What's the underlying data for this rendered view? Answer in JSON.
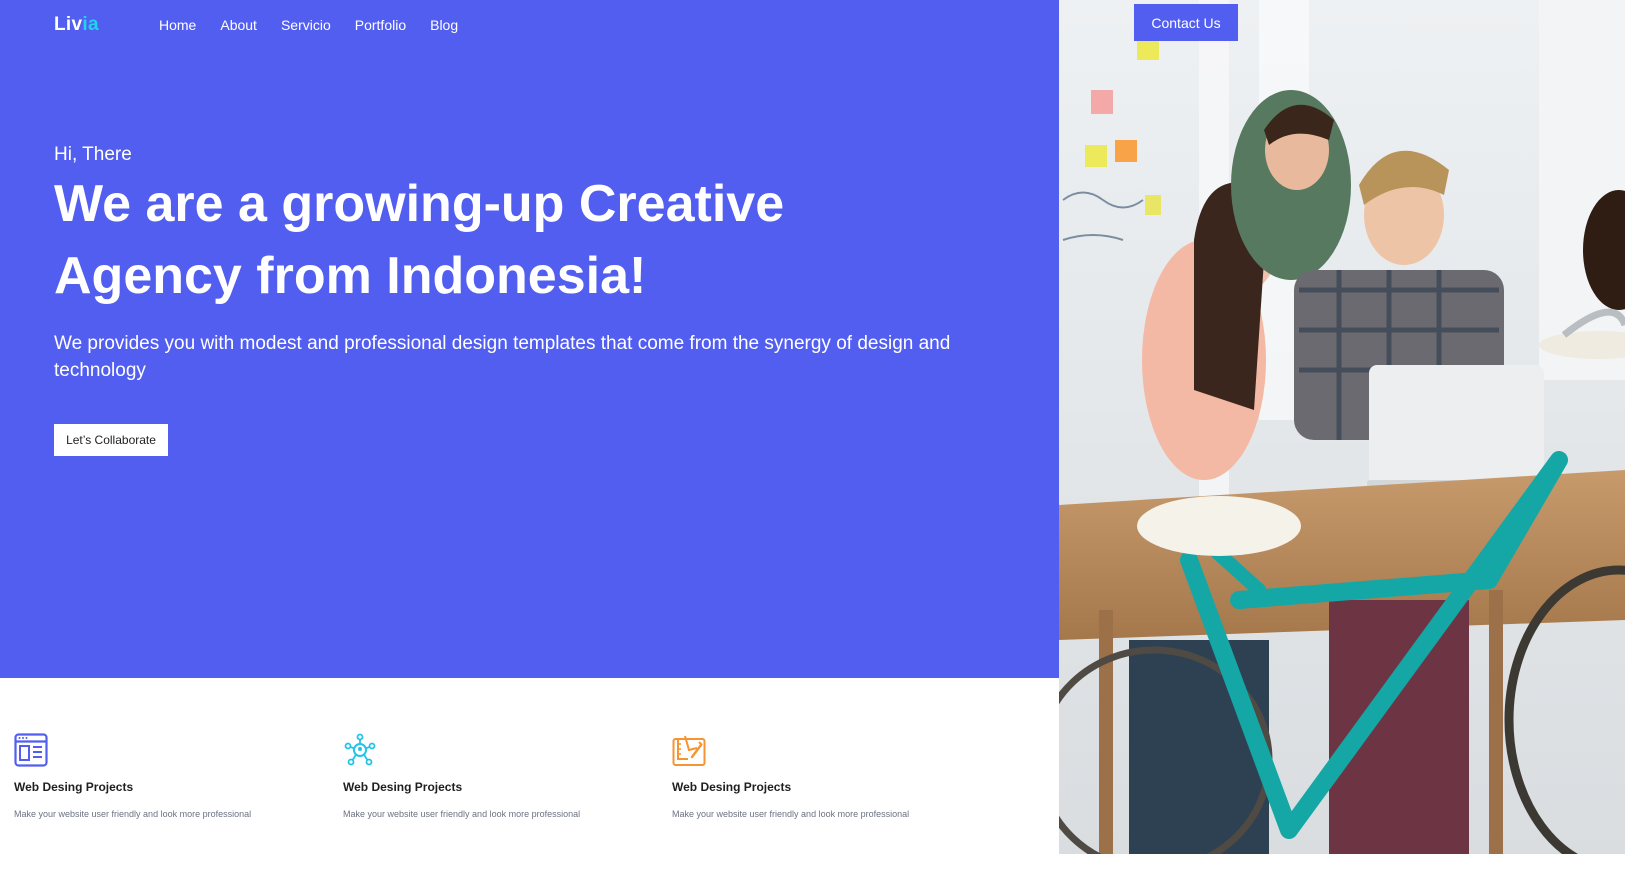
{
  "brand": {
    "logo_main": "Liv",
    "logo_accent": "ia"
  },
  "nav": {
    "items": [
      {
        "label": "Home"
      },
      {
        "label": "About"
      },
      {
        "label": "Servicio"
      },
      {
        "label": "Portfolio"
      },
      {
        "label": "Blog"
      }
    ],
    "contact_label": "Contact Us"
  },
  "hero": {
    "greeting": "Hi, There",
    "headline": "We are a growing-up Creative Agency from Indonesia!",
    "subtext": "We provides you with modest and professional design templates that come from the synergy of design and technology",
    "cta_label": "Let’s Collaborate"
  },
  "features": [
    {
      "icon": "browser-window-icon",
      "title": "Web Desing Projects",
      "description": "Make your website user friendly and look more professional"
    },
    {
      "icon": "network-hub-icon",
      "title": "Web Desing Projects",
      "description": "Make your website user friendly and look more professional"
    },
    {
      "icon": "design-tools-icon",
      "title": "Web Desing Projects",
      "description": "Make your website user friendly and look more professional"
    }
  ],
  "colors": {
    "primary": "#525ef0",
    "logo_accent": "#22d3ee",
    "icon_blue": "#525ef0",
    "icon_cyan": "#22c3e6",
    "icon_orange": "#f59432"
  }
}
